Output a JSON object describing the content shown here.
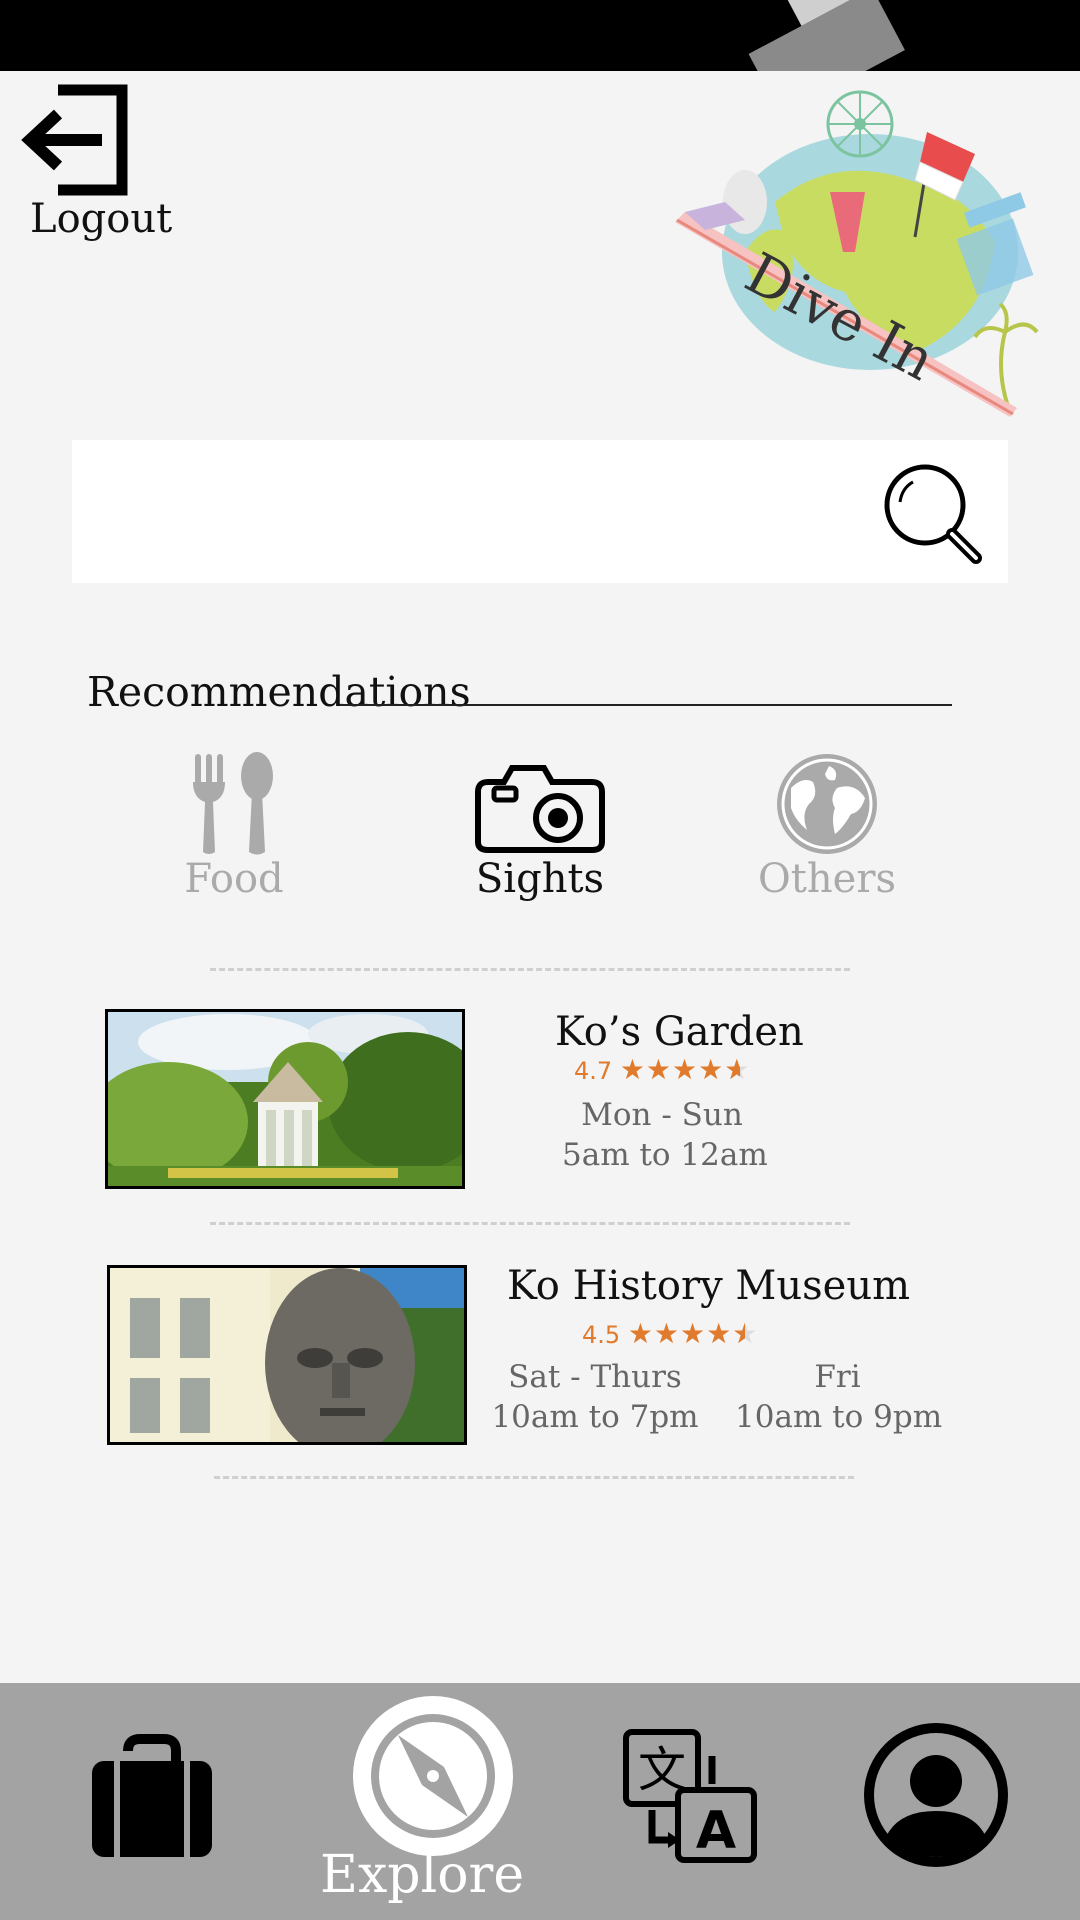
{
  "header": {
    "logout_label": "Logout",
    "logo_text": "Dive In"
  },
  "search": {
    "value": "",
    "placeholder": ""
  },
  "recommendations": {
    "heading": "Recommendations",
    "categories": [
      {
        "label": "Food",
        "icon": "fork-spoon-icon",
        "active": false
      },
      {
        "label": "Sights",
        "icon": "camera-icon",
        "active": true
      },
      {
        "label": "Others",
        "icon": "globe-icon",
        "active": false
      }
    ]
  },
  "places": [
    {
      "name": "Ko’s Garden",
      "rating": "4.7",
      "rating_value": 4.7,
      "hours": [
        {
          "days": "Mon - Sun",
          "time": "5am to 12am"
        }
      ],
      "image": "gazebo-garden-photo"
    },
    {
      "name": "Ko History Museum",
      "rating": "4.5",
      "rating_value": 4.5,
      "hours": [
        {
          "days": "Sat - Thurs",
          "time": "10am to 7pm"
        },
        {
          "days": "Fri",
          "time": "10am to 9pm"
        }
      ],
      "image": "stone-head-museum-photo"
    }
  ],
  "bottom_nav": {
    "items": [
      {
        "icon": "luggage-icon",
        "label": ""
      },
      {
        "icon": "compass-icon",
        "label": "Explore",
        "active": true
      },
      {
        "icon": "translate-icon",
        "label": ""
      },
      {
        "icon": "profile-icon",
        "label": ""
      }
    ]
  },
  "colors": {
    "accent": "#e07a2c",
    "nav_bg": "#a3a3a3",
    "page_bg": "#f4f4f4",
    "inactive": "#aaaaaa"
  }
}
